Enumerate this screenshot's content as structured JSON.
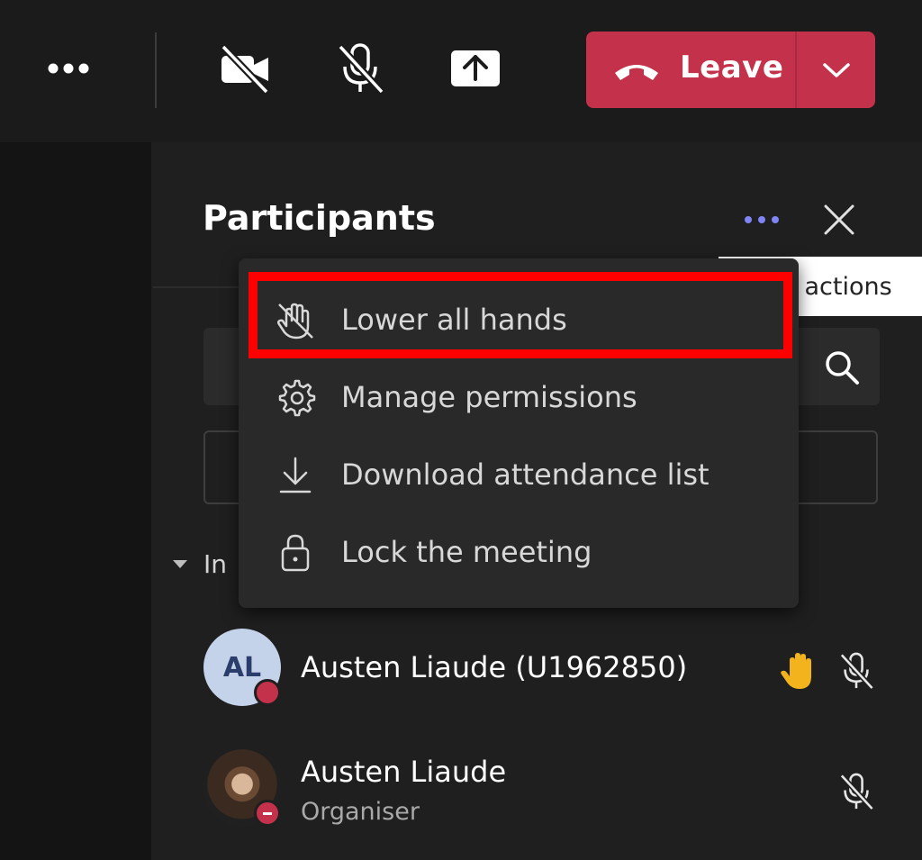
{
  "toolbar": {
    "leave_label": "Leave"
  },
  "panel": {
    "title": "Participants"
  },
  "tooltip": {
    "text": "More actions"
  },
  "menu": {
    "items": [
      {
        "label": "Lower all hands",
        "icon": "hand-off-icon",
        "highlighted": true
      },
      {
        "label": "Manage permissions",
        "icon": "gear-icon"
      },
      {
        "label": "Download attendance list",
        "icon": "download-icon"
      },
      {
        "label": "Lock the meeting",
        "icon": "lock-icon"
      }
    ]
  },
  "section": {
    "label": "In"
  },
  "participants": [
    {
      "name": "Austen Liaude (U1962850)",
      "initials": "AL",
      "role": "",
      "hand_raised": true,
      "muted": true
    },
    {
      "name": "Austen Liaude",
      "initials": "",
      "role": "Organiser",
      "hand_raised": false,
      "muted": true
    }
  ],
  "colors": {
    "leave": "#c4314b",
    "accent": "#7f85f5",
    "highlight": "#ff0000",
    "hand": "#f2b31d"
  }
}
